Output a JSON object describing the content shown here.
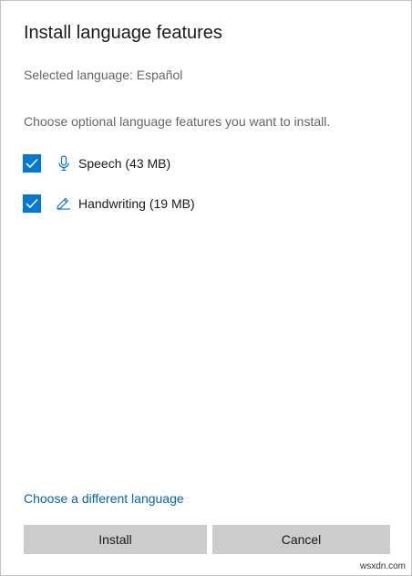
{
  "dialog": {
    "title": "Install language features",
    "selected_language": "Selected language: Español",
    "instruction": "Choose optional language features you want to install.",
    "features": [
      {
        "label": "Speech (43 MB)",
        "checked": true,
        "icon": "microphone-icon"
      },
      {
        "label": "Handwriting (19 MB)",
        "checked": true,
        "icon": "pen-icon"
      }
    ],
    "different_language_link": "Choose a different language",
    "install_label": "Install",
    "cancel_label": "Cancel"
  },
  "watermark": "wsxdn.com",
  "colors": {
    "accent": "#0078d7",
    "link": "#0067b8",
    "button_bg": "#cccccc",
    "secondary_text": "#666666"
  }
}
